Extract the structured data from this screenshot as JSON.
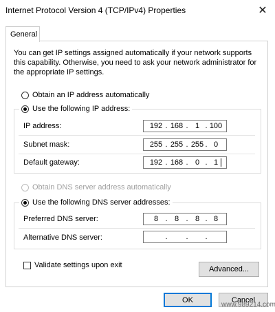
{
  "window": {
    "title": "Internet Protocol Version 4 (TCP/IPv4) Properties",
    "close_glyph": "✕"
  },
  "tabs": [
    {
      "label": "General"
    }
  ],
  "description": "You can get IP settings assigned automatically if your network supports this capability. Otherwise, you need to ask your network administrator for the appropriate IP settings.",
  "ip_mode": {
    "auto_label": "Obtain an IP address automatically",
    "manual_label": "Use the following IP address:",
    "selected": "manual"
  },
  "ip_fields": {
    "ip_address": {
      "label": "IP address:",
      "octets": [
        "192",
        "168",
        "1",
        "100"
      ]
    },
    "subnet_mask": {
      "label": "Subnet mask:",
      "octets": [
        "255",
        "255",
        "255",
        "0"
      ]
    },
    "default_gateway": {
      "label": "Default gateway:",
      "octets": [
        "192",
        "168",
        "0",
        "1"
      ]
    }
  },
  "dns_mode": {
    "auto_label": "Obtain DNS server address automatically",
    "manual_label": "Use the following DNS server addresses:",
    "selected": "manual"
  },
  "dns_fields": {
    "preferred": {
      "label": "Preferred DNS server:",
      "octets": [
        "8",
        "8",
        "8",
        "8"
      ]
    },
    "alternate": {
      "label": "Alternative DNS server:",
      "octets": [
        "",
        "",
        "",
        ""
      ]
    }
  },
  "validate": {
    "label": "Validate settings upon exit",
    "checked": false
  },
  "buttons": {
    "advanced": "Advanced...",
    "ok": "OK",
    "cancel": "Cancel"
  },
  "watermark": "www.989214.com",
  "colors": {
    "accent": "#0078d7",
    "button_face": "#e1e1e1",
    "disabled_text": "#a0a0a0"
  }
}
